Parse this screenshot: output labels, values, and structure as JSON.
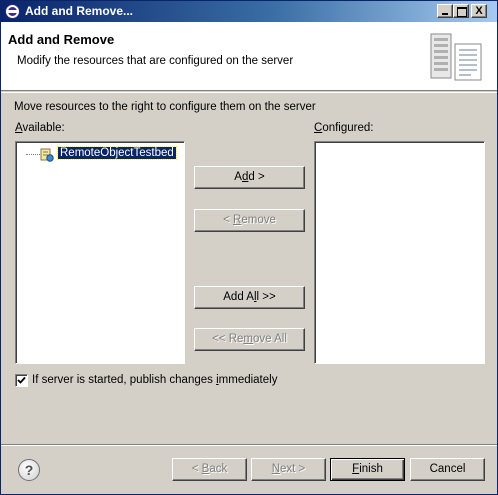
{
  "window": {
    "title": "Add and Remove...",
    "controls": {
      "minimize": "_",
      "maximize": "□",
      "close": "X"
    }
  },
  "header": {
    "title": "Add and Remove",
    "description": "Modify the resources that are configured on the server",
    "icon": "server-icon"
  },
  "body": {
    "instruction": "Move resources to the right to configure them on the server",
    "available_label": {
      "mnemonic": "A",
      "rest": "vailable:"
    },
    "configured_label": {
      "mnemonic": "C",
      "rest": "onfigured:"
    },
    "available_items": [
      {
        "label": "RemoteObjectTestbed",
        "icon": "project-icon",
        "selected": true
      }
    ],
    "configured_items": []
  },
  "buttons": {
    "add": {
      "pre": "A",
      "mnemonic": "d",
      "post": "d >",
      "enabled": true
    },
    "remove": {
      "pre": "< ",
      "mnemonic": "R",
      "post": "emove",
      "enabled": false
    },
    "add_all": {
      "pre": "Add A",
      "mnemonic": "l",
      "post": "l >>",
      "enabled": true
    },
    "remove_all": {
      "pre": "<< Re",
      "mnemonic": "m",
      "post": "ove All",
      "enabled": false
    }
  },
  "publish_option": {
    "checked": true,
    "pre": "If server is started, publish changes ",
    "mnemonic": "i",
    "post": "mmediately"
  },
  "footer": {
    "help_icon": "help-icon",
    "back": {
      "pre": "< ",
      "mnemonic": "B",
      "post": "ack",
      "enabled": false
    },
    "next": {
      "pre": "",
      "mnemonic": "N",
      "post": "ext >",
      "enabled": false
    },
    "finish": {
      "pre": "",
      "mnemonic": "F",
      "post": "inish",
      "enabled": true
    },
    "cancel": {
      "label": "Cancel",
      "enabled": true
    }
  }
}
